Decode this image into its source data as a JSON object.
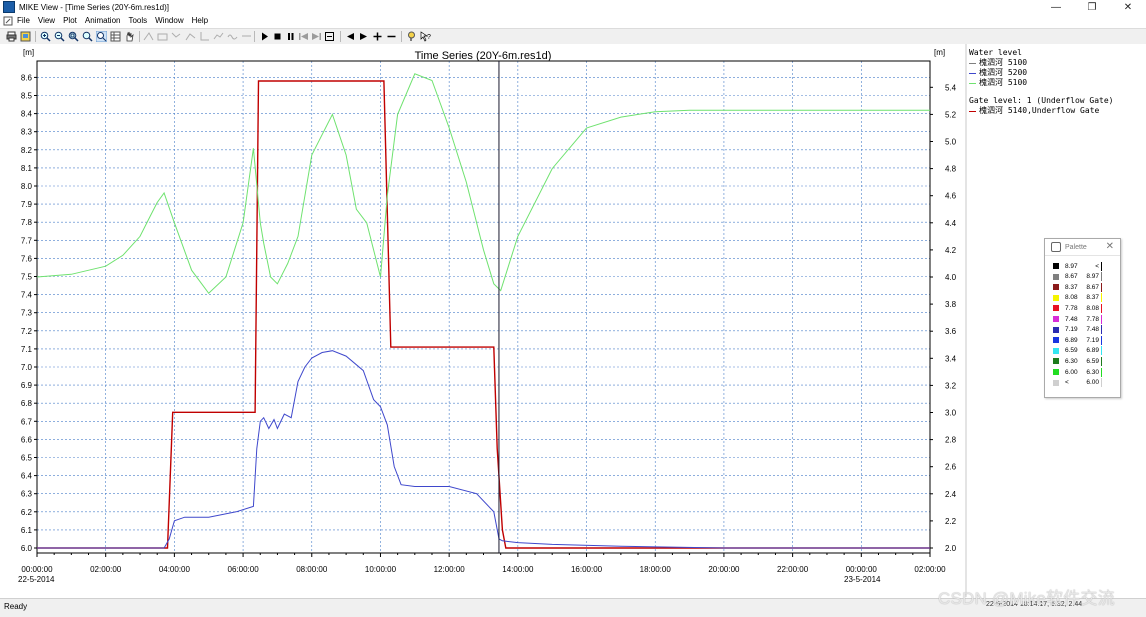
{
  "window": {
    "title": "MIKE View - [Time Series (20Y-6m.res1d)]",
    "minimize": "—",
    "restore": "❐",
    "close": "✕"
  },
  "menu": {
    "items": [
      "File",
      "View",
      "Plot",
      "Animation",
      "Tools",
      "Window",
      "Help"
    ]
  },
  "plot": {
    "title": "Time Series (20Y-6m.res1d)",
    "left_unit": "[m]",
    "right_unit": "[m]",
    "left_ticks": [
      "6.0",
      "6.1",
      "6.2",
      "6.3",
      "6.4",
      "6.5",
      "6.6",
      "6.7",
      "6.8",
      "6.9",
      "7.0",
      "7.1",
      "7.2",
      "7.3",
      "7.4",
      "7.5",
      "7.6",
      "7.7",
      "7.8",
      "7.9",
      "8.0",
      "8.1",
      "8.2",
      "8.3",
      "8.4",
      "8.5",
      "8.6"
    ],
    "right_ticks": [
      "2.0",
      "2.2",
      "2.4",
      "2.6",
      "2.8",
      "3.0",
      "3.2",
      "3.4",
      "3.6",
      "3.8",
      "4.0",
      "4.2",
      "4.4",
      "4.6",
      "4.8",
      "5.0",
      "5.2",
      "5.4"
    ],
    "time_ticks": [
      "00:00:00",
      "02:00:00",
      "04:00:00",
      "06:00:00",
      "08:00:00",
      "10:00:00",
      "12:00:00",
      "14:00:00",
      "16:00:00",
      "18:00:00",
      "20:00:00",
      "22:00:00",
      "00:00:00",
      "02:00:00"
    ],
    "date_start": "22-5-2014",
    "date_end": "23-5-2014",
    "cursor_time_hours": 13.45
  },
  "legend": {
    "group1_title": "Water level",
    "group1_items": [
      {
        "label": "槐泗河 5100",
        "color": "#7f7f7f"
      },
      {
        "label": "槐泗河 5200",
        "color": "#3f48cc"
      },
      {
        "label": "槐泗河 5100",
        "color": "#6fe26f"
      }
    ],
    "group2_title": "Gate level: 1 (Underflow Gate)",
    "group2_items": [
      {
        "label": "槐泗河 5140,Underflow Gate",
        "color": "#c00000"
      }
    ]
  },
  "palette": {
    "title": "Palette",
    "close": "✕",
    "rows": [
      {
        "lo": "8.97",
        "hi": "<",
        "color": "#000000"
      },
      {
        "lo": "8.67",
        "hi": "8.97",
        "color": "#7f7f7f"
      },
      {
        "lo": "8.37",
        "hi": "8.67",
        "color": "#8b1a1a"
      },
      {
        "lo": "8.08",
        "hi": "8.37",
        "color": "#f5f500"
      },
      {
        "lo": "7.78",
        "hi": "8.08",
        "color": "#e81123"
      },
      {
        "lo": "7.48",
        "hi": "7.78",
        "color": "#d82bd8"
      },
      {
        "lo": "7.19",
        "hi": "7.48",
        "color": "#2b2bb0"
      },
      {
        "lo": "6.89",
        "hi": "7.19",
        "color": "#1a35e0"
      },
      {
        "lo": "6.59",
        "hi": "6.89",
        "color": "#33e6f2"
      },
      {
        "lo": "6.30",
        "hi": "6.59",
        "color": "#1d7a1d"
      },
      {
        "lo": "6.00",
        "hi": "6.30",
        "color": "#22dd22"
      },
      {
        "lo": "<",
        "hi": "6.00",
        "color": "#cfcfcf"
      }
    ]
  },
  "chart_data": {
    "type": "line",
    "title": "Time Series (20Y-6m.res1d)",
    "x_unit": "hours since 22-5-2014 00:00",
    "xlim": [
      0,
      26
    ],
    "ylim_left": [
      6.0,
      8.65
    ],
    "ylim_right": [
      2.0,
      5.5
    ],
    "grid": true,
    "legend_position": "right",
    "series": [
      {
        "name": "槐泗河 5140,Underflow Gate",
        "axis": "left",
        "color": "#c00000",
        "x": [
          0,
          3.8,
          3.95,
          6.35,
          6.45,
          10.1,
          10.3,
          13.3,
          13.4,
          13.55,
          13.65,
          26
        ],
        "y": [
          6.0,
          6.0,
          6.75,
          6.75,
          8.58,
          8.58,
          7.11,
          7.11,
          6.55,
          6.1,
          6.0,
          6.0
        ]
      },
      {
        "name": "槐泗河 5200",
        "axis": "left",
        "color": "#3f48cc",
        "x": [
          0,
          3.7,
          3.85,
          4.0,
          4.3,
          5.0,
          5.8,
          6.3,
          6.4,
          6.5,
          6.6,
          6.75,
          6.9,
          7.0,
          7.2,
          7.4,
          7.6,
          7.8,
          8.0,
          8.3,
          8.6,
          9.0,
          9.5,
          9.8,
          10.0,
          10.2,
          10.4,
          10.6,
          11.0,
          12.0,
          12.8,
          13.3,
          13.45,
          13.55,
          14,
          15,
          17,
          20,
          26
        ],
        "y": [
          6.0,
          6.0,
          6.05,
          6.15,
          6.17,
          6.17,
          6.2,
          6.23,
          6.55,
          6.7,
          6.72,
          6.66,
          6.71,
          6.66,
          6.74,
          6.72,
          6.92,
          7.0,
          7.05,
          7.08,
          7.09,
          7.06,
          6.98,
          6.82,
          6.78,
          6.68,
          6.45,
          6.35,
          6.34,
          6.34,
          6.3,
          6.2,
          6.05,
          6.04,
          6.03,
          6.02,
          6.01,
          6.0,
          6.0
        ]
      },
      {
        "name": "槐泗河 5100",
        "axis": "right",
        "color": "#6fe26f",
        "x": [
          0,
          1,
          2,
          2.5,
          3,
          3.3,
          3.5,
          3.7,
          4.0,
          4.5,
          5.0,
          5.5,
          6.0,
          6.3,
          6.5,
          6.6,
          6.8,
          7.0,
          7.3,
          7.6,
          8.0,
          8.3,
          8.6,
          9.0,
          9.3,
          9.6,
          9.8,
          10.0,
          10.2,
          10.5,
          11.0,
          11.5,
          12.0,
          12.5,
          13.0,
          13.3,
          13.5,
          14.0,
          15.0,
          16.0,
          17.0,
          18.0,
          19.0,
          20.0,
          22.0,
          26.0
        ],
        "y": [
          4.0,
          4.02,
          4.08,
          4.16,
          4.3,
          4.45,
          4.55,
          4.62,
          4.4,
          4.05,
          3.88,
          4.0,
          4.4,
          4.95,
          4.4,
          4.25,
          4.0,
          3.95,
          4.1,
          4.3,
          4.9,
          5.05,
          5.2,
          4.9,
          4.5,
          4.4,
          4.2,
          4.0,
          4.6,
          5.2,
          5.5,
          5.45,
          5.1,
          4.7,
          4.2,
          3.95,
          3.9,
          4.3,
          4.8,
          5.1,
          5.18,
          5.22,
          5.23,
          5.23,
          5.23,
          5.23
        ]
      }
    ]
  },
  "status": {
    "ready": "Ready",
    "coord": "22-5-2014 18:14:17, 6.32, 2.44"
  },
  "watermark": "CSDN @Mike软件交流"
}
